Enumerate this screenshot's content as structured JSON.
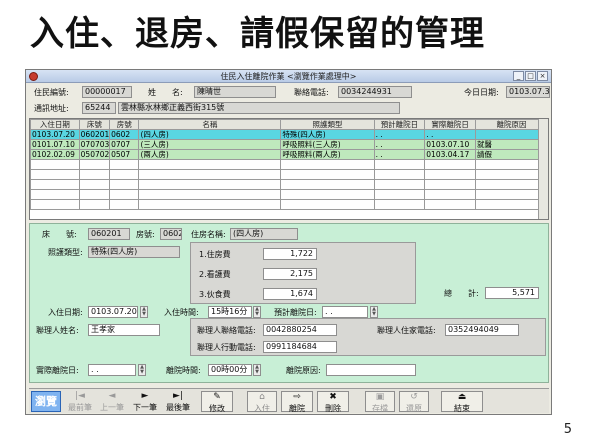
{
  "slide": {
    "title": "入住、退房、請假保留的管理",
    "page_number": "5"
  },
  "window": {
    "title": "住民入住離院作業 <瀏覽作業處理中>"
  },
  "header": {
    "resident_id_label": "住民編號:",
    "resident_id": "00000017",
    "name_label": "姓　　名:",
    "name": "陳晴世",
    "phone_label": "聯絡電話:",
    "phone": "0034244931",
    "today_label": "今日日期:",
    "today": "0103.07.31",
    "address_label": "通訊地址:",
    "postal_code": "65244",
    "address": "雲林縣水林鄉正義西街315號"
  },
  "grid": {
    "columns": [
      "入住日期",
      "床號",
      "房號",
      "名稱",
      "照護類型",
      "預計離院日",
      "實際離院日",
      "離院原因"
    ],
    "rows": [
      [
        "0103.07.20",
        "060201",
        "0602",
        "(四人房)",
        "特殊(四人房)",
        ". .",
        ". .",
        ""
      ],
      [
        "0101.07.10",
        "070703",
        "0707",
        "(三人房)",
        "呼吸照料(三人房)",
        ". .",
        "0103.07.10",
        "就醫"
      ],
      [
        "0102.02.09",
        "050702",
        "0507",
        "(兩人房)",
        "呼吸照料(兩人房)",
        ". .",
        "0103.04.17",
        "請假"
      ]
    ]
  },
  "detail": {
    "bed_label": "床　　號:",
    "bed": "060201",
    "room_label": "房號:",
    "room": "0602",
    "room_name_label": "住房名稱:",
    "room_name": "(四人房)",
    "care_type_label": "照護類型:",
    "care_type": "特殊(四人房)",
    "fees": [
      {
        "label": "1.住房費",
        "value": "1,722"
      },
      {
        "label": "2.看護費",
        "value": "2,175"
      },
      {
        "label": "3.伙食費",
        "value": "1,674"
      }
    ],
    "total_label": "總　　計:",
    "total": "5,571",
    "checkin_date_label": "入住日期:",
    "checkin_date": "0103.07.20",
    "checkin_time_label": "入住時間:",
    "checkin_time": "15時16分",
    "expected_leave_label": "預計離院日:",
    "expected_leave": ". .",
    "contact_name_label": "聯理人姓名:",
    "contact_name": "王孝家",
    "contact_phone_label": "聯理人聯絡電話:",
    "contact_phone": "0042880254",
    "contact_home_label": "聯理人住家電話:",
    "contact_home": "0352494049",
    "contact_mobile_label": "聯理人行動電話:",
    "contact_mobile": "0991184684",
    "actual_leave_label": "實際離院日:",
    "actual_leave": ". .",
    "leave_time_label": "離院時間:",
    "leave_time": "00時00分",
    "leave_reason_label": "離院原因:",
    "leave_reason": ""
  },
  "toolbar": {
    "browse": "瀏覽",
    "first": "最前筆",
    "prev": "上一筆",
    "next": "下一筆",
    "last": "最後筆",
    "edit": "修改",
    "checkin": "入住",
    "discharge": "離院",
    "delete": "刪除",
    "save": "存檔",
    "restore": "還原",
    "exit": "結束"
  },
  "colors": {
    "selected_row": "#59d6e2",
    "green_row": "#bfe9bd",
    "detail_bg": "#c8efd6",
    "browse_button": "#7fb3f0"
  }
}
